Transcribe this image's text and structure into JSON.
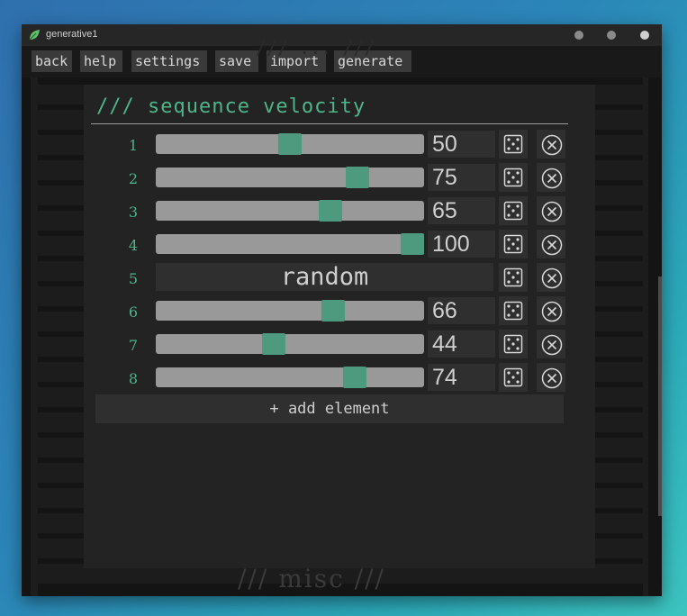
{
  "window": {
    "title": "generative1"
  },
  "menu": {
    "items": [
      "back",
      "help",
      "settings",
      "save",
      "import",
      "generate"
    ]
  },
  "background": {
    "ghost_top": "/// ... ///",
    "ghost_bottom": "/// misc ///"
  },
  "panel": {
    "title": "/// sequence velocity",
    "add_label": "+ add element",
    "rows": [
      {
        "index": "1",
        "mode": "value",
        "value": "50",
        "level": 0.5
      },
      {
        "index": "2",
        "mode": "value",
        "value": "75",
        "level": 0.75
      },
      {
        "index": "3",
        "mode": "value",
        "value": "65",
        "level": 0.65
      },
      {
        "index": "4",
        "mode": "value",
        "value": "100",
        "level": 1.0
      },
      {
        "index": "5",
        "mode": "random",
        "value": "random"
      },
      {
        "index": "6",
        "mode": "value",
        "value": "66",
        "level": 0.66
      },
      {
        "index": "7",
        "mode": "value",
        "value": "44",
        "level": 0.44
      },
      {
        "index": "8",
        "mode": "value",
        "value": "74",
        "level": 0.74
      }
    ]
  },
  "icons": {
    "app": "leaf-icon",
    "dice": "dice-icon",
    "remove": "close-circle-icon"
  },
  "colors": {
    "accent": "#4fb48a",
    "thumb": "#4e9a7f",
    "slider_track": "#999999"
  }
}
